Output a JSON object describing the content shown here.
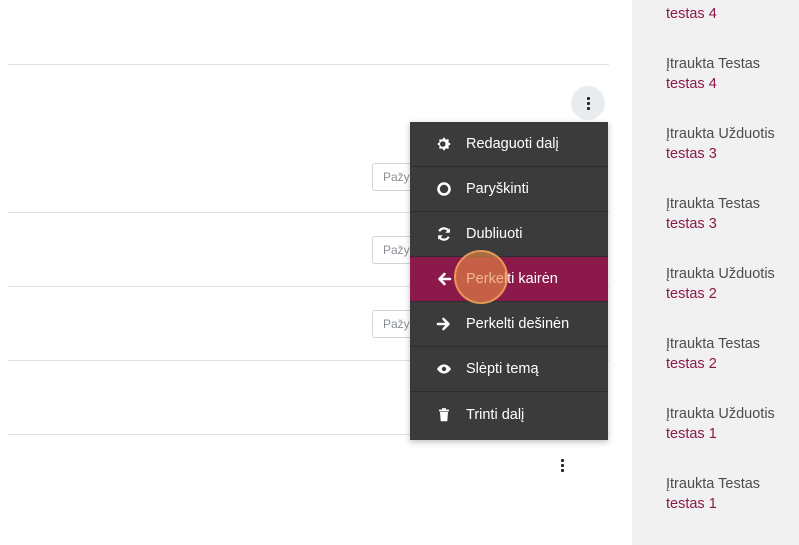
{
  "course_sections": {
    "mark_input_placeholder": "Pažymėti",
    "rows": 3
  },
  "context_menu": {
    "items": [
      {
        "label": "Redaguoti dalį",
        "icon": "gear-icon"
      },
      {
        "label": "Paryškinti",
        "icon": "circle-outline-icon"
      },
      {
        "label": "Dubliuoti",
        "icon": "sync-icon"
      },
      {
        "label": "Perkelti kairėn",
        "icon": "arrow-left-icon",
        "highlighted": true
      },
      {
        "label": "Perkelti dešinėn",
        "icon": "arrow-right-icon"
      },
      {
        "label": "Slėpti temą",
        "icon": "eye-icon"
      },
      {
        "label": "Trinti dalį",
        "icon": "trash-icon"
      }
    ]
  },
  "recent_activity": {
    "top_partial": "testas 4",
    "items": [
      {
        "type": "Įtraukta Testas",
        "name": "testas 4"
      },
      {
        "type": "Įtraukta Užduotis",
        "name": "testas 3"
      },
      {
        "type": "Įtraukta Testas",
        "name": "testas 3"
      },
      {
        "type": "Įtraukta Užduotis",
        "name": "testas 2"
      },
      {
        "type": "Įtraukta Testas",
        "name": "testas 2"
      },
      {
        "type": "Įtraukta Užduotis",
        "name": "testas 1"
      },
      {
        "type": "Įtraukta Testas",
        "name": "testas 1"
      }
    ]
  },
  "colors": {
    "accent": "#8b1a4a",
    "menu_bg": "#3b3b3b",
    "sidebar_bg": "#f1f1f1"
  }
}
